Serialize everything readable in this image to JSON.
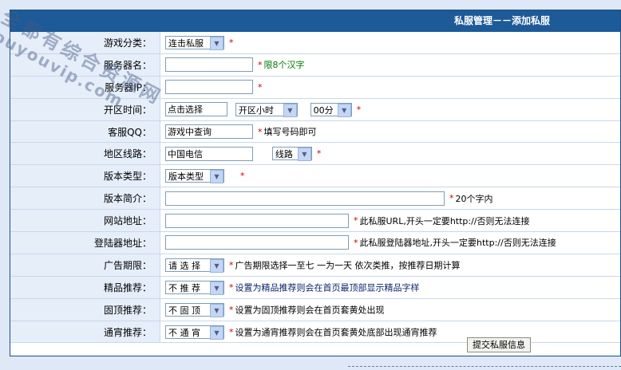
{
  "header": {
    "title": "私服管理－－添加私服"
  },
  "watermark": {
    "line1": "全都有综合资源网",
    "line2": "douyouvip.com"
  },
  "rows": [
    {
      "label": "游戏分类：",
      "select": "连击私服",
      "star": "*",
      "hint": ""
    },
    {
      "label": "服务器名：",
      "star": "*",
      "hint": "限8个汉字"
    },
    {
      "label": "服务器IP：",
      "star": "*"
    },
    {
      "label": "开区时间：",
      "input": "点击选择",
      "hour_select": "开区小时",
      "minute_select": "00分",
      "star": "*"
    },
    {
      "label": "客服QQ：",
      "input": "游戏中查询",
      "star": "*",
      "hint": "填写号码即可"
    },
    {
      "label": "地区线路：",
      "input": "中国电信",
      "select": "线路",
      "star": "*"
    },
    {
      "label": "版本类型：",
      "select": "版本类型",
      "star": "*"
    },
    {
      "label": "版本简介：",
      "star": "*",
      "hint": "20个字内"
    },
    {
      "label": "网站地址：",
      "star": "*",
      "hint": "此私服URL,开头一定要http://否则无法连接"
    },
    {
      "label": "登陆器地址：",
      "star": "*",
      "hint": "此私服登陆器地址,开头一定要http://否则无法连接"
    },
    {
      "label": "广告期限：",
      "select": "请 选 择",
      "star": "*",
      "hint": "广告期限选择一至七 一为一天 依次类推，按推荐日期计算"
    },
    {
      "label": "精品推荐：",
      "select": "不 推 荐",
      "star": "*",
      "hint": "设置为精品推荐则会在首页最顶部显示精品字样"
    },
    {
      "label": "固顶推荐：",
      "select": "不 固 顶",
      "star": "*",
      "hint": "设置为固顶推荐则会在首页套黄处出现"
    },
    {
      "label": "通宵推荐：",
      "select": "不 通 宵",
      "star": "*",
      "hint": "设置为通宵推荐则会在首页套黄处底部出现通宵推荐"
    }
  ],
  "submit_label": "提交私服信息"
}
